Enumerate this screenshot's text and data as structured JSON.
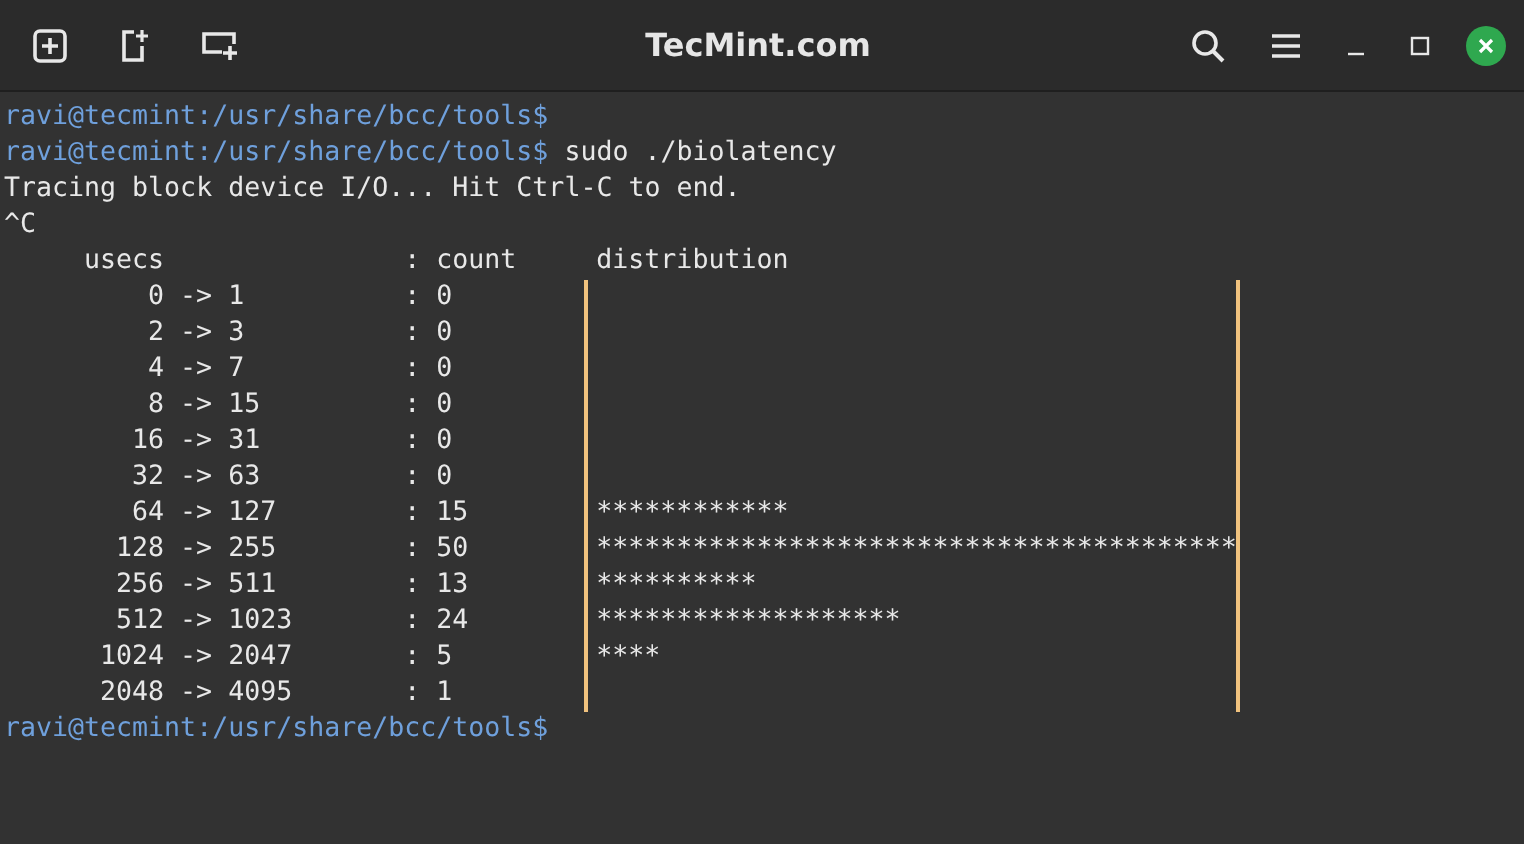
{
  "window": {
    "title": "TecMint.com"
  },
  "terminal": {
    "lines": [
      {
        "kind": "prompt",
        "prompt": "ravi@tecmint:/usr/share/bcc/tools$"
      },
      {
        "kind": "prompt",
        "prompt": "ravi@tecmint:/usr/share/bcc/tools$",
        "command": "sudo ./biolatency"
      },
      {
        "kind": "output",
        "text": "Tracing block device I/O... Hit Ctrl-C to end."
      },
      {
        "kind": "output",
        "text": "^C"
      },
      {
        "kind": "header",
        "range": "usecs",
        "count": ": count",
        "bar": "distribution"
      },
      {
        "kind": "row",
        "from": "0",
        "arrow": "->",
        "to": "1",
        "count": ": 0"
      },
      {
        "kind": "row",
        "from": "2",
        "arrow": "->",
        "to": "3",
        "count": ": 0"
      },
      {
        "kind": "row",
        "from": "4",
        "arrow": "->",
        "to": "7",
        "count": ": 0"
      },
      {
        "kind": "row",
        "from": "8",
        "arrow": "->",
        "to": "15",
        "count": ": 0"
      },
      {
        "kind": "row",
        "from": "16",
        "arrow": "->",
        "to": "31",
        "count": ": 0"
      },
      {
        "kind": "row",
        "from": "32",
        "arrow": "->",
        "to": "63",
        "count": ": 0"
      },
      {
        "kind": "row",
        "from": "64",
        "arrow": "->",
        "to": "127",
        "count": ": 15",
        "bar": "************"
      },
      {
        "kind": "row",
        "from": "128",
        "arrow": "->",
        "to": "255",
        "count": ": 50",
        "bar": "****************************************"
      },
      {
        "kind": "row",
        "from": "256",
        "arrow": "->",
        "to": "511",
        "count": ": 13",
        "bar": "**********"
      },
      {
        "kind": "row",
        "from": "512",
        "arrow": "->",
        "to": "1023",
        "count": ": 24",
        "bar": "*******************"
      },
      {
        "kind": "row",
        "from": "1024",
        "arrow": "->",
        "to": "2047",
        "count": ": 5",
        "bar": "****"
      },
      {
        "kind": "row",
        "from": "2048",
        "arrow": "->",
        "to": "4095",
        "count": ": 1"
      },
      {
        "kind": "prompt",
        "prompt": "ravi@tecmint:/usr/share/bcc/tools$"
      }
    ]
  }
}
